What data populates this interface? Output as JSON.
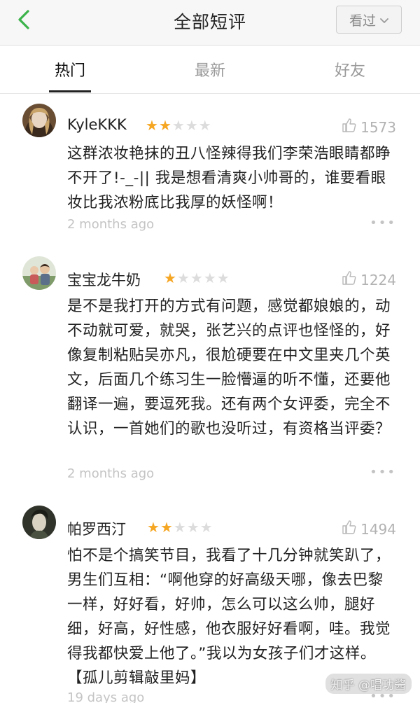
{
  "header": {
    "title": "全部短评",
    "watch_label": "看过"
  },
  "tabs": [
    {
      "label": "热门",
      "active": true
    },
    {
      "label": "最新",
      "active": false
    },
    {
      "label": "好友",
      "active": false
    }
  ],
  "reviews": [
    {
      "username": "KyleKKK",
      "rating": 2,
      "likes": "1573",
      "text": "这群浓妆艳抹的丑八怪辣得我们李荣浩眼睛都睁不开了!-_-|| 我是想看清爽小帅哥的，谁要看眼妆比我浓粉底比我厚的妖怪啊！",
      "time": "2 months ago"
    },
    {
      "username": "宝宝龙牛奶",
      "rating": 1,
      "likes": "1224",
      "text": "是不是我打开的方式有问题，感觉都娘娘的，动不动就可爱，就哭，张艺兴的点评也怪怪的，好像复制粘贴吴亦凡，很尬硬要在中文里夹几个英文，后面几个练习生一脸懵逼的听不懂，还要他翻译一遍，要逗死我。还有两个女评委，完全不认识，一首她们的歌也没听过，有资格当评委？",
      "time": "2 months ago"
    },
    {
      "username": "帕罗西汀",
      "rating": 2,
      "likes": "1494",
      "text": "怕不是个搞笑节目，我看了十几分钟就笑趴了，男生们互相：“啊他穿的好高级天哪，像去巴黎一样，好好看，好帅，怎么可以这么帅，腿好细，好高，好性感，他衣服好好看啊，哇。我觉得我都快爱上他了。”我以为女孩子们才这样。【孤儿剪辑敲里妈】",
      "time": "19 days ago"
    }
  ],
  "more_symbol": "•••",
  "star_symbol": "★",
  "watermark": "知乎 @唱功酱",
  "colors": {
    "accent_green": "#3bb34a",
    "star": "#f5a623",
    "star_off": "#dcdcdc"
  }
}
